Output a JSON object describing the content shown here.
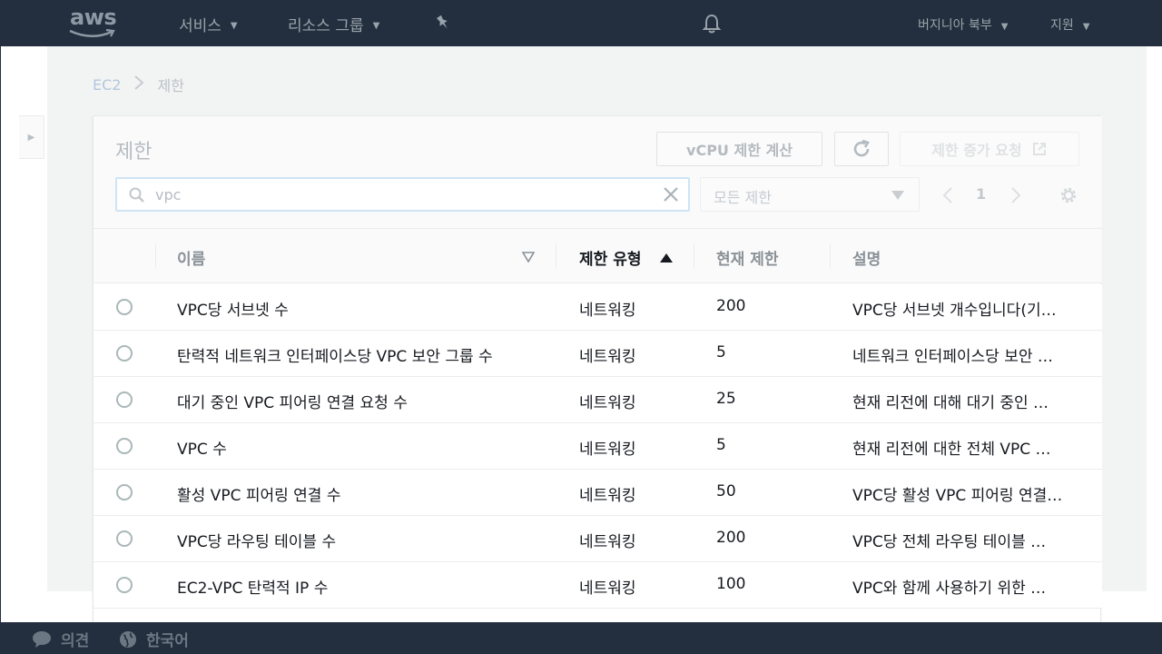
{
  "topnav": {
    "logo": "aws",
    "services": "서비스",
    "resource_groups": "리소스 그룹",
    "region": "버지니아 북부",
    "support": "지원",
    "icons": [
      "chevron-down-icon",
      "pin-icon",
      "bell-icon"
    ]
  },
  "breadcrumb": {
    "parent": "EC2",
    "current": "제한"
  },
  "panel": {
    "title": "제한",
    "vcpu_button": "vCPU 제한 계산",
    "increase_button": "제한 증가 요청",
    "search_value": "vpc",
    "filter_selected": "모든 제한",
    "page_number": "1"
  },
  "columns": {
    "name": "이름",
    "type": "제한 유형",
    "current_limit": "현재 제한",
    "description": "설명"
  },
  "rows": [
    {
      "name": "VPC당 서브넷 수",
      "type": "네트워킹",
      "limit": "200",
      "desc": "VPC당 서브넷 개수입니다(기…"
    },
    {
      "name": "탄력적 네트워크 인터페이스당 VPC 보안 그룹 수",
      "type": "네트워킹",
      "limit": "5",
      "desc": "네트워크 인터페이스당 보안 …"
    },
    {
      "name": "대기 중인 VPC 피어링 연결 요청 수",
      "type": "네트워킹",
      "limit": "25",
      "desc": "현재 리전에 대해 대기 중인 …"
    },
    {
      "name": "VPC 수",
      "type": "네트워킹",
      "limit": "5",
      "desc": "현재 리전에 대한 전체 VPC …"
    },
    {
      "name": "활성 VPC 피어링 연결 수",
      "type": "네트워킹",
      "limit": "50",
      "desc": "VPC당 활성 VPC 피어링 연결…"
    },
    {
      "name": "VPC당 라우팅 테이블 수",
      "type": "네트워킹",
      "limit": "200",
      "desc": "VPC당 전체 라우팅 테이블 …"
    },
    {
      "name": "EC2-VPC 탄력적 IP 수",
      "type": "네트워킹",
      "limit": "100",
      "desc": "VPC와 함께 사용하기 위한 …"
    }
  ],
  "footer": {
    "feedback": "의견",
    "language": "한국어"
  },
  "colors": {
    "nav_bg": "#232f3e",
    "panel_bg": "#f2f3f3",
    "text": "#16191f"
  }
}
